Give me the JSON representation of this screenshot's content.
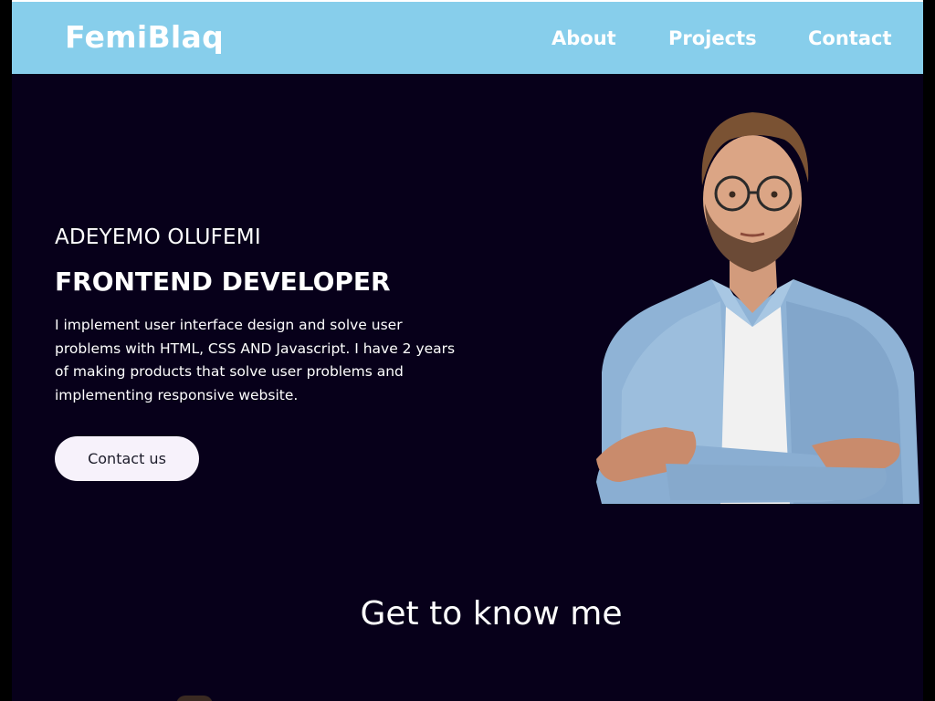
{
  "header": {
    "brand": "FemiBlaq",
    "nav": {
      "about": "About",
      "projects": "Projects",
      "contact": "Contact"
    }
  },
  "hero": {
    "name": "ADEYEMO OLUFEMI",
    "role": "FRONTEND DEVELOPER",
    "description": "I implement user interface design and solve user problems with HTML, CSS AND Javascript. I have 2 years of making products that solve user problems and implementing responsive website.",
    "cta_label": "Contact us",
    "portrait_alt": "portrait"
  },
  "about": {
    "title": "Get to know me"
  },
  "colors": {
    "header_bg": "#87ceeb",
    "page_bg": "#07001a",
    "button_bg": "#f7f2fb",
    "text": "#ffffff"
  }
}
